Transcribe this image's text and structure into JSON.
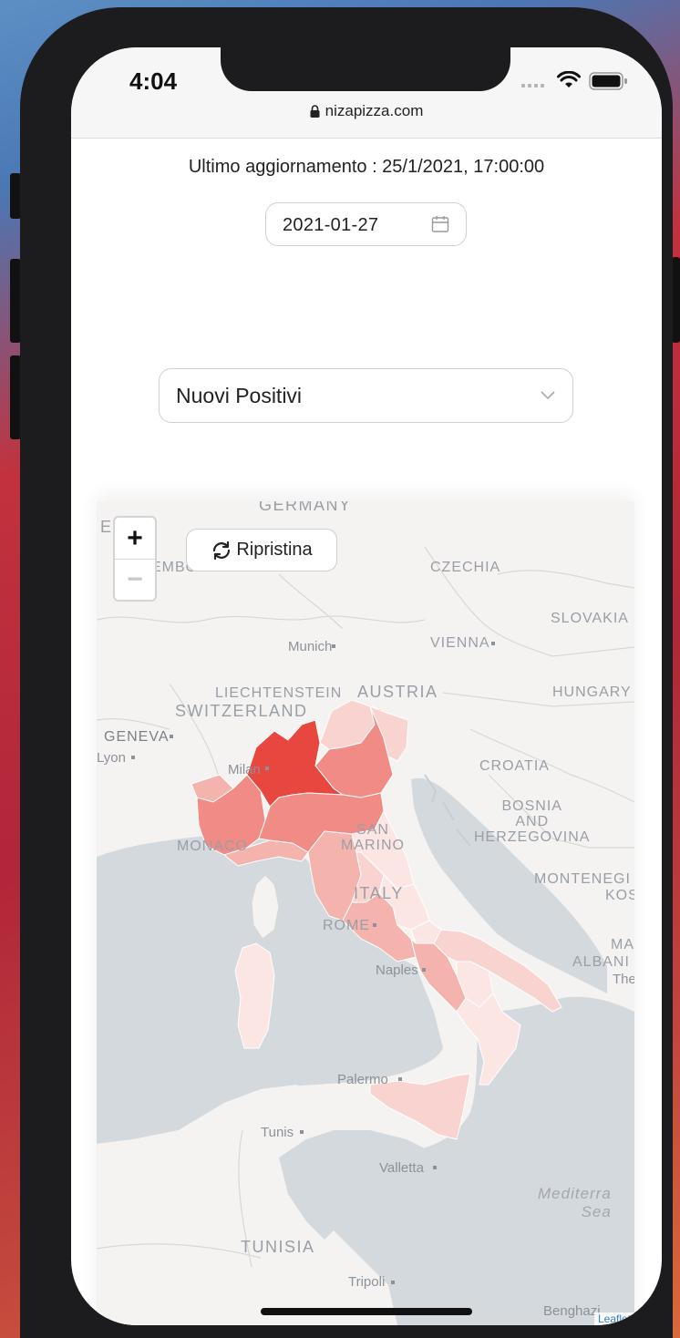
{
  "status_bar": {
    "time": "4:04",
    "url": "nizapizza.com"
  },
  "header": {
    "last_update": "Ultimo aggiornamento : 25/1/2021, 17:00:00",
    "date_value": "2021-01-27"
  },
  "metric_select": {
    "selected": "Nuovi Positivi"
  },
  "map": {
    "controls": {
      "zoom_in": "+",
      "zoom_out": "−",
      "reset_label": "Ripristina"
    },
    "labels": {
      "germany": "GERMANY",
      "czechia": "CZECHIA",
      "slovakia": "SLOVAKIA",
      "munich": "Munich",
      "vienna": "VIENNA",
      "liechtenstein": "LIECHTENSTEIN",
      "austria": "AUSTRIA",
      "hungary": "HUNGARY",
      "switzerland": "SWITZERLAND",
      "geneva": "GENEVA",
      "lyon": "Lyon",
      "milan": "Milan",
      "croatia": "CROATIA",
      "bosnia": "BOSNIA\nAND\nHERZEGOVINA",
      "monaco": "MONACO",
      "san_marino": "SAN\nMARINO",
      "montenegro": "MONTENEGI",
      "kosovo": "KOS",
      "italy": "ITALY",
      "rome": "ROME",
      "albania": "ALBANI",
      "naples": "Naples",
      "palermo": "Palermo",
      "tunis": "Tunis",
      "valletta": "Valletta",
      "mediterranean": "Mediterra\nSea",
      "tunisia": "TUNISIA",
      "tripoli": "Tripoli",
      "benghazi": "Benghazi",
      "bern_frag": "EMBO",
      "em_frag": "E M",
      "ma_frag": "MA",
      "the_frag": "The"
    },
    "region_colors": {
      "lombardia": "#e8473f",
      "high": "#f08b86",
      "mid": "#f5b3ae",
      "low": "#f8d3d0",
      "lowest": "#fbe6e4",
      "sea": "#d4d9dd",
      "land": "#f4f3f1"
    },
    "attribution": "Leaflet"
  }
}
